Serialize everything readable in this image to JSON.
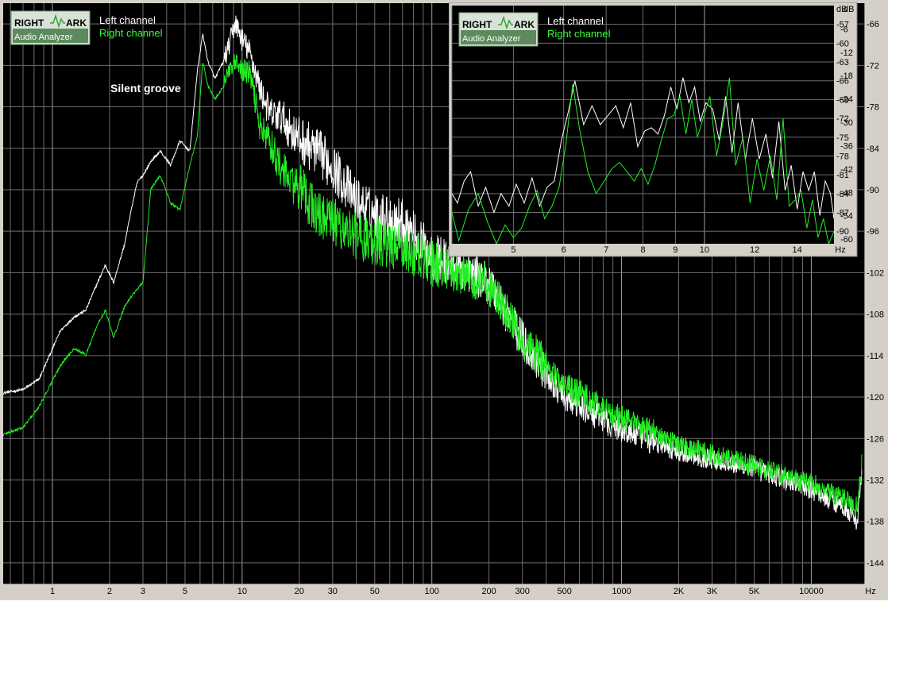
{
  "logo": {
    "line1_left": "RIGHT",
    "line1_right": "ARK",
    "line2": "Audio Analyzer"
  },
  "legend": {
    "left": "Left channel",
    "right": "Right channel"
  },
  "colors": {
    "left": "#ffffff",
    "right": "#22ee22",
    "background": "#000000",
    "frame": "#d4d0c8",
    "grid": "#8c8c8c",
    "logo_bg": "#d6e3d6",
    "logo_box": "#5d8a5d"
  },
  "chart_data": [
    {
      "type": "line",
      "title": "",
      "annotation": "Silent groove",
      "xscale": "log",
      "xlim": [
        0.55,
        19000
      ],
      "ylim": [
        -147,
        -63
      ],
      "grid": true,
      "legend_position": "top-left",
      "x_unit_label": "Hz",
      "x_ticks": [
        1,
        2,
        3,
        5,
        10,
        20,
        30,
        50,
        100,
        200,
        300,
        500,
        1000,
        2000,
        3000,
        5000,
        10000
      ],
      "x_tick_labels": [
        "1",
        "2",
        "3",
        "5",
        "10",
        "20",
        "30",
        "50",
        "100",
        "200",
        "300",
        "500",
        "1000",
        "2K",
        "3K",
        "5K",
        "10000"
      ],
      "y_ticks": [
        -66,
        -72,
        -78,
        -84,
        -90,
        -96,
        -102,
        -108,
        -114,
        -120,
        -126,
        -132,
        -138,
        -144
      ],
      "y_tick_labels": [
        "-66",
        "-72",
        "-78",
        "-84",
        "-90",
        "-96",
        "-102",
        "-108",
        "-114",
        "-120",
        "-126",
        "-132",
        "-138",
        "-144"
      ],
      "series": [
        {
          "name": "Left channel",
          "x": [
            0.55,
            0.7,
            0.85,
            1.1,
            1.3,
            1.5,
            1.7,
            1.9,
            2.1,
            2.4,
            2.6,
            2.8,
            3.0,
            3.3,
            3.7,
            4.2,
            4.7,
            5.3,
            5.8,
            6.2,
            6.6,
            7.2,
            7.8,
            8.4,
            9.2,
            10.0,
            11.0,
            12.5,
            14.0,
            16.0,
            18.0,
            20.0,
            25.0,
            30.0,
            40.0,
            50.0,
            70.0,
            100.0,
            150.0,
            200.0,
            300.0,
            500.0,
            1000.0,
            2000.0,
            5000.0,
            10000.0,
            15000.0,
            17500.0,
            18500.0
          ],
          "y": [
            -119.5,
            -119.0,
            -117.5,
            -110.5,
            -108.5,
            -107.5,
            -104.0,
            -101.0,
            -103.5,
            -98.0,
            -93.0,
            -89.0,
            -88.0,
            -86.0,
            -84.5,
            -86.5,
            -83.0,
            -84.5,
            -73.0,
            -67.5,
            -71.5,
            -74.0,
            -72.0,
            -70.5,
            -66.5,
            -69.0,
            -71.0,
            -76.5,
            -80.0,
            -80.5,
            -82.5,
            -84.0,
            -86.0,
            -88.0,
            -93.0,
            -95.0,
            -96.0,
            -101.0,
            -103.0,
            -104.5,
            -113.0,
            -121.0,
            -125.5,
            -128.5,
            -131.0,
            -134.0,
            -136.5,
            -138.5,
            -131.0
          ]
        },
        {
          "name": "Right channel",
          "x": [
            0.55,
            0.7,
            0.85,
            1.1,
            1.3,
            1.5,
            1.7,
            1.9,
            2.1,
            2.4,
            2.6,
            2.8,
            3.0,
            3.3,
            3.7,
            4.2,
            4.7,
            5.3,
            5.8,
            6.2,
            6.6,
            7.2,
            7.8,
            8.4,
            9.2,
            10.0,
            11.0,
            12.5,
            14.0,
            16.0,
            18.0,
            20.0,
            25.0,
            30.0,
            40.0,
            50.0,
            70.0,
            100.0,
            150.0,
            200.0,
            300.0,
            500.0,
            1000.0,
            2000.0,
            5000.0,
            10000.0,
            15000.0,
            17500.0,
            18500.0
          ],
          "y": [
            -125.5,
            -124.5,
            -121.5,
            -115.5,
            -113.0,
            -114.0,
            -110.0,
            -107.5,
            -111.5,
            -107.0,
            -105.5,
            -104.5,
            -103.5,
            -90.0,
            -88.0,
            -92.0,
            -93.0,
            -86.5,
            -82.5,
            -71.5,
            -75.0,
            -77.0,
            -75.5,
            -74.0,
            -72.5,
            -73.5,
            -74.0,
            -82.0,
            -84.0,
            -88.0,
            -90.0,
            -91.0,
            -95.0,
            -96.0,
            -98.0,
            -99.0,
            -100.0,
            -102.0,
            -103.5,
            -105.0,
            -113.0,
            -119.0,
            -124.0,
            -127.5,
            -130.5,
            -133.0,
            -135.5,
            -136.5,
            -130.0
          ]
        }
      ]
    },
    {
      "type": "line",
      "title": "",
      "xscale": "log",
      "xlim": [
        4.0,
        16.0
      ],
      "ylim": [
        -92,
        -54
      ],
      "grid": true,
      "legend_position": "top-left",
      "x_unit_label": "Hz",
      "y_unit_label": "dB",
      "x_ticks": [
        5,
        6,
        7,
        8,
        9,
        10,
        12,
        14
      ],
      "x_tick_labels": [
        "5",
        "6",
        "7",
        "8",
        "9",
        "10",
        "12",
        "14"
      ],
      "y_ticks_left": [
        -57,
        -60,
        -63,
        -66,
        -69,
        -72,
        -75,
        -78,
        -81,
        -84,
        -87,
        -90
      ],
      "y_tick_labels_left": [
        "-57",
        "-60",
        "-63",
        "-66",
        "-69",
        "-72",
        "-75",
        "-78",
        "-81",
        "-84",
        "-87",
        "-90"
      ],
      "y_ticks_right": [
        -6,
        -12,
        -18,
        -24,
        -30,
        -36,
        -42,
        -48,
        -54,
        -60
      ],
      "y_tick_labels_right": [
        "-6",
        "-12",
        "-18",
        "-24",
        "-30",
        "-36",
        "-42",
        "-48",
        "-54",
        "-60"
      ],
      "series": [
        {
          "name": "Left channel",
          "x": [
            4.0,
            4.08,
            4.18,
            4.28,
            4.4,
            4.52,
            4.66,
            4.78,
            4.92,
            5.05,
            5.2,
            5.35,
            5.5,
            5.65,
            5.8,
            5.95,
            6.1,
            6.25,
            6.45,
            6.65,
            6.85,
            7.05,
            7.25,
            7.45,
            7.65,
            7.85,
            8.05,
            8.25,
            8.45,
            8.65,
            8.85,
            9.05,
            9.25,
            9.45,
            9.65,
            9.85,
            10.05,
            10.3,
            10.55,
            10.8,
            11.05,
            11.3,
            11.6,
            11.9,
            12.2,
            12.5,
            12.8,
            13.1,
            13.4,
            13.7,
            14.0,
            14.3,
            14.6,
            14.9,
            15.2,
            15.5,
            15.8,
            16.0
          ],
          "y": [
            -84.0,
            -85.5,
            -82.0,
            -80.5,
            -86.0,
            -83.0,
            -87.0,
            -84.0,
            -86.0,
            -82.5,
            -85.5,
            -81.5,
            -86.0,
            -83.0,
            -82.0,
            -75.5,
            -71.0,
            -66.0,
            -73.0,
            -70.0,
            -73.0,
            -71.5,
            -70.0,
            -73.5,
            -69.5,
            -76.5,
            -74.0,
            -73.5,
            -74.5,
            -71.5,
            -67.0,
            -70.5,
            -65.5,
            -69.5,
            -67.0,
            -72.5,
            -69.5,
            -70.5,
            -75.5,
            -68.5,
            -77.5,
            -69.5,
            -78.5,
            -72.0,
            -78.5,
            -74.5,
            -81.5,
            -72.5,
            -83.5,
            -79.5,
            -86.5,
            -80.5,
            -83.5,
            -80.5,
            -87.5,
            -82.0,
            -84.0,
            -88.0
          ]
        },
        {
          "name": "Right channel",
          "x": [
            4.0,
            4.1,
            4.25,
            4.4,
            4.55,
            4.7,
            4.85,
            5.0,
            5.15,
            5.3,
            5.45,
            5.6,
            5.75,
            5.9,
            6.05,
            6.2,
            6.35,
            6.55,
            6.75,
            6.95,
            7.15,
            7.35,
            7.55,
            7.75,
            7.95,
            8.15,
            8.35,
            8.55,
            8.75,
            8.95,
            9.15,
            9.35,
            9.55,
            9.75,
            9.95,
            10.2,
            10.45,
            10.7,
            10.95,
            11.2,
            11.5,
            11.8,
            12.1,
            12.4,
            12.7,
            13.0,
            13.3,
            13.6,
            13.9,
            14.2,
            14.5,
            14.8,
            15.1,
            15.4,
            15.7,
            16.0
          ],
          "y": [
            -87.0,
            -91.5,
            -86.5,
            -84.0,
            -88.5,
            -92.0,
            -89.0,
            -91.0,
            -89.5,
            -86.0,
            -83.5,
            -88.0,
            -86.0,
            -83.0,
            -76.0,
            -66.5,
            -73.5,
            -80.5,
            -84.0,
            -82.0,
            -80.0,
            -79.0,
            -80.5,
            -82.0,
            -80.0,
            -82.5,
            -79.5,
            -75.5,
            -72.0,
            -71.5,
            -68.5,
            -74.5,
            -69.0,
            -75.0,
            -72.0,
            -68.5,
            -78.0,
            -72.5,
            -65.5,
            -79.5,
            -75.0,
            -85.5,
            -78.5,
            -83.5,
            -78.0,
            -85.0,
            -72.0,
            -86.0,
            -85.0,
            -83.5,
            -89.5,
            -85.0,
            -91.0,
            -88.0,
            -92.0,
            -90.0
          ]
        }
      ]
    }
  ]
}
